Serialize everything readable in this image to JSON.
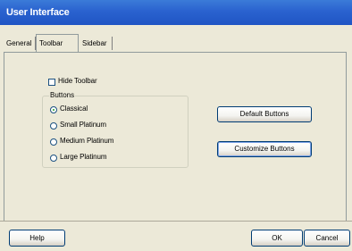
{
  "window": {
    "title": "User Interface"
  },
  "tabs": [
    {
      "label": "General"
    },
    {
      "label": "Toolbar"
    },
    {
      "label": "Sidebar"
    }
  ],
  "toolbar_page": {
    "hide_toolbar": {
      "label": "Hide Toolbar",
      "checked": false
    },
    "buttons_group": {
      "title": "Buttons",
      "options": [
        {
          "label": "Classical",
          "checked": true
        },
        {
          "label": "Small Platinum",
          "checked": false
        },
        {
          "label": "Medium Platinum",
          "checked": false
        },
        {
          "label": "Large Platinum",
          "checked": false
        }
      ]
    },
    "default_buttons_label": "Default Buttons",
    "customize_buttons_label": "Customize Buttons"
  },
  "footer": {
    "help_label": "Help",
    "ok_label": "OK",
    "cancel_label": "Cancel"
  },
  "colors": {
    "titlebar": "#2a62cf",
    "dialog_bg": "#ece9d8",
    "button_border": "#003c74",
    "radio_dot": "#21a121"
  }
}
